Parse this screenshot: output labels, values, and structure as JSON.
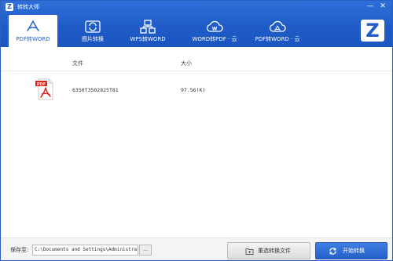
{
  "app": {
    "title": "转转大师",
    "logo_letter": "Z",
    "brand_letter": "Z"
  },
  "window_controls": {
    "minimize": "—",
    "close": "✕"
  },
  "tabs": [
    {
      "label": "PDF转WORD",
      "icon": "pdf-convert-icon",
      "active": true
    },
    {
      "label": "图片转换",
      "icon": "image-convert-icon",
      "active": false
    },
    {
      "label": "WPS转WORD",
      "icon": "wps-convert-icon",
      "active": false
    },
    {
      "label": "WORD转PDF · 云",
      "icon": "cloud-word-icon",
      "active": false
    },
    {
      "label": "PDF转WORD · 云",
      "icon": "cloud-pdf-icon",
      "active": false
    }
  ],
  "table": {
    "columns": {
      "file": "文件",
      "size": "大小"
    },
    "rows": [
      {
        "icon_label": "PDF",
        "name": "6350T3502825T81",
        "size": "97.56(K)"
      }
    ]
  },
  "footer": {
    "save_label": "保存至:",
    "save_path": "C:\\Documents and Settings\\Administrator",
    "browse_label": "...",
    "reselect_label": "重选转换文件",
    "start_label": "开始转换"
  },
  "colors": {
    "header_blue": "#1f5cc9",
    "active_tab_text": "#2866cc",
    "pdf_red": "#d9251d"
  }
}
